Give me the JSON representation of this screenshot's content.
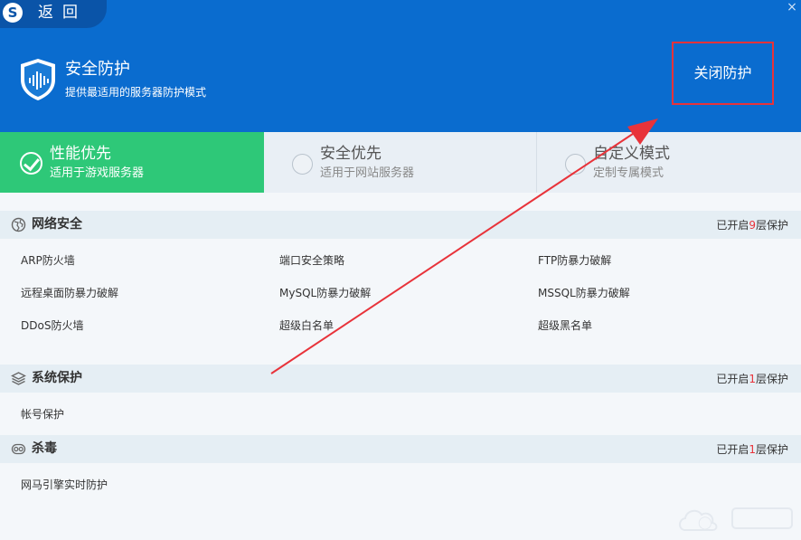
{
  "titlebar": {
    "logo_text": "S",
    "back_label": "返回",
    "close_glyph": "×"
  },
  "header": {
    "title": "安全防护",
    "subtitle": "提供最适用的服务器防护模式",
    "close_button_label": "关闭防护",
    "highlight_color": "#e8333a",
    "background_color": "#0a6ccf"
  },
  "modes": [
    {
      "name": "性能优先",
      "desc": "适用于游戏服务器",
      "selected": true
    },
    {
      "name": "安全优先",
      "desc": "适用于网站服务器",
      "selected": false
    },
    {
      "name": "自定义模式",
      "desc": "定制专属模式",
      "selected": false
    }
  ],
  "sections": {
    "network": {
      "title": "网络安全",
      "status_prefix": "已开启",
      "status_count": "9",
      "status_suffix": "层保护",
      "items": [
        "ARP防火墙",
        "端口安全策略",
        "FTP防暴力破解",
        "远程桌面防暴力破解",
        "MySQL防暴力破解",
        "MSSQL防暴力破解",
        "DDoS防火墙",
        "超级白名单",
        "超级黑名单"
      ]
    },
    "system": {
      "title": "系统保护",
      "status_prefix": "已开启",
      "status_count": "1",
      "status_suffix": "层保护",
      "items": [
        "帐号保护"
      ]
    },
    "antivirus": {
      "title": "杀毒",
      "status_prefix": "已开启",
      "status_count": "1",
      "status_suffix": "层保护",
      "items": [
        "网马引擎实时防护"
      ]
    }
  },
  "colors": {
    "selected_mode": "#2ec878",
    "status_count": "#e8333a",
    "annotation_arrow": "#e8333a"
  }
}
